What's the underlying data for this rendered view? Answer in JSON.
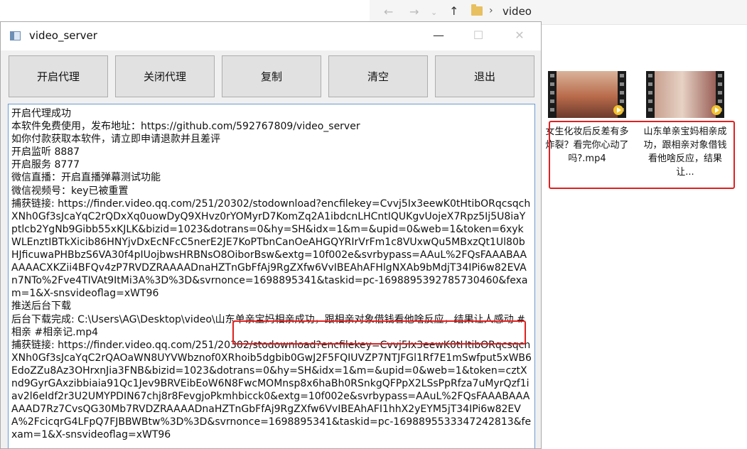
{
  "explorer": {
    "back_icon": "arrow-left-icon",
    "forward_icon": "arrow-right-icon",
    "up_icon": "arrow-up-icon",
    "separator": "›",
    "path": "video",
    "files": [
      {
        "name": "女生化妆后反差有多炸裂？看完你心动了吗?.mp4",
        "thumb_color": "#b86a4a"
      },
      {
        "name": "山东单亲宝妈相亲成功，跟相亲对象借钱看他啥反应，结果让...",
        "thumb_color": "#9a6058"
      }
    ]
  },
  "window": {
    "title": "video_server",
    "minimize_glyph": "—",
    "maximize_glyph": "☐",
    "close_glyph": "✕"
  },
  "toolbar": {
    "start_proxy": "开启代理",
    "stop_proxy": "关闭代理",
    "copy": "复制",
    "clear": "清空",
    "exit": "退出"
  },
  "log": {
    "lines": [
      "开启代理成功",
      "本软件免费使用，发布地址：https://github.com/592767809/video_server",
      "如你付款获取本软件，请立即申请退款并且差评",
      "开启监听 8887",
      "开启服务 8777",
      "微信直播：开启直播弹幕测试功能",
      "微信视频号：key已被重置",
      "捕获链接: https://finder.video.qq.com/251/20302/stodownload?encfilekey=Cvvj5Ix3eewK0tHtibORqcsqchXNh0Gf3sJcaYqC2rQDxXq0uowDyQ9XHvz0rYOMyrD7KomZq2A1ibdcnLHCntIQUKgvUojeX7Rpz5Ij5U8iaYptlcb2YgNb9Gibb55xKJLK&bizid=1023&dotrans=0&hy=SH&idx=1&m=&upid=0&web=1&token=6xykWLEnztIBTkXicib86HNYjvDxEcNFcC5nerE2JE7KoPTbnCanOeAHGQYRIrVrFm1c8VUxwQu5MBxzQt1Ul80bHJficuwaPHBbzS6VA30f4pIUojbwsHRBNsO8OiborBsw&extg=10f002e&svrbypass=AAuL%2FQsFAAABAAAAAACXKZii4BFQv4zP7RVDZRAAAADnaHZTnGbFfAj9RgZXfw6VvIBEAhAFHlgNXAb9bMdjT34IPi6w82EVAn7NTo%2Fve4TIVAt9ItMi3A%3D%3D&svrnonce=1698895341&taskid=pc-1698895392785730460&fexam=1&X-snsvideoflag=xWT96",
      "推送后台下载",
      "后台下载完成: C:\\Users\\AG\\Desktop\\video\\山东单亲宝妈相亲成功，跟相亲对象借钱看他啥反应，结果让人感动 #相亲 #相亲记.mp4",
      "捕获链接: https://finder.video.qq.com/251/20302/stodownload?encfilekey=Cvvj5Ix3eewK0tHtibORqcsqchXNh0Gf3sJcaYqC2rQAOaWN8UYVWbznof0XRhoib5dgbib0GwJ2F5FQIUVZP7NTJFGl1Rf7E1mSwfput5xWB6EdoZZu8Az3OHrxnJia3FNB&bizid=1023&dotrans=0&hy=SH&idx=1&m=&upid=0&web=1&token=cztXnd9GyrGAxzibbiaia91Qc1Jev9BRVEibEoW6N8FwcMOMnsp8x6haBh0RSnkgQFPpX2LSsPpRfza7uMyrQzf1iav2l6eIdf2r3U2UMYPDIN67chj8r8FevgjoPkmhbicck0&extg=10f002e&svrbypass=AAuL%2FQsFAAABAAAAAAD7Rz7CvsQG30Mb7RVDZRAAAADnaHZTnGbFfAj9RgZXfw6VvIBEAhAFI1hhX2yEYM5jT34IPi6w82EVA%2FcicqrG4LFpQ7FJBBWBtw%3D%3D&svrnonce=1698895341&taskid=pc-1698895533347242813&fexam=1&X-snsvideoflag=xWT96"
    ]
  }
}
